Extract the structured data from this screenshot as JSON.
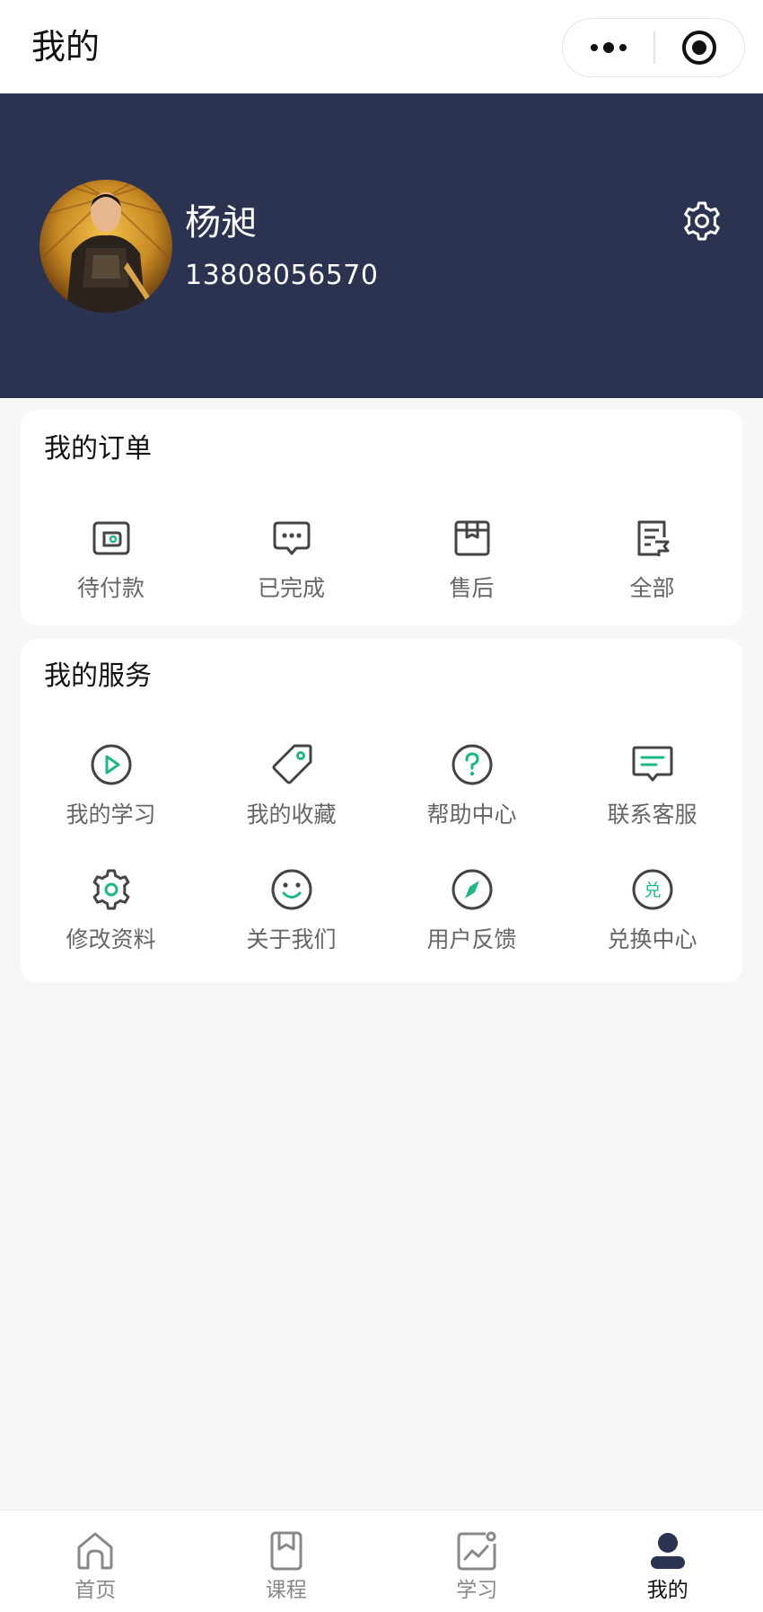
{
  "header": {
    "title": "我的",
    "menu_icon": "more-dots-icon",
    "close_icon": "target-circle-icon"
  },
  "profile": {
    "name": "杨昶",
    "phone": "13808056570",
    "settings_icon": "gear-icon",
    "avatar_icon": "user-avatar"
  },
  "orders": {
    "title": "我的订单",
    "items": [
      {
        "label": "待付款",
        "icon": "wallet-icon"
      },
      {
        "label": "已完成",
        "icon": "chat-bubble-dots-icon"
      },
      {
        "label": "售后",
        "icon": "box-icon"
      },
      {
        "label": "全部",
        "icon": "document-list-icon"
      }
    ]
  },
  "services": {
    "title": "我的服务",
    "items": [
      {
        "label": "我的学习",
        "icon": "play-circle-icon"
      },
      {
        "label": "我的收藏",
        "icon": "tag-icon"
      },
      {
        "label": "帮助中心",
        "icon": "question-circle-icon"
      },
      {
        "label": "联系客服",
        "icon": "message-icon"
      },
      {
        "label": "修改资料",
        "icon": "gear-icon"
      },
      {
        "label": "关于我们",
        "icon": "smiley-icon"
      },
      {
        "label": "用户反馈",
        "icon": "compass-icon"
      },
      {
        "label": "兑换中心",
        "icon": "exchange-icon",
        "glyph": "兑"
      }
    ]
  },
  "tabbar": {
    "items": [
      {
        "label": "首页",
        "icon": "home-icon"
      },
      {
        "label": "课程",
        "icon": "bookmark-icon"
      },
      {
        "label": "学习",
        "icon": "chart-icon"
      },
      {
        "label": "我的",
        "icon": "person-icon",
        "active": true
      }
    ]
  },
  "colors": {
    "banner_bg": "#2c3350",
    "accent": "#1fb586",
    "icon_stroke": "#444444",
    "active_tab": "#2c3350"
  }
}
